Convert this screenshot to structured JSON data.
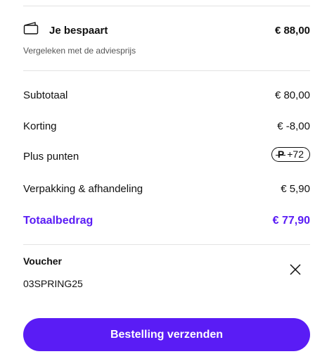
{
  "savings": {
    "title": "Je bespaart",
    "amount": "€ 88,00",
    "subtitle": "Vergeleken met de adviesprijs",
    "icon": "wallet-icon"
  },
  "summary": {
    "subtotal_label": "Subtotaal",
    "subtotal_value": "€ 80,00",
    "discount_label": "Korting",
    "discount_value": "€ -8,00",
    "points_label": "Plus punten",
    "points_value": "+72",
    "points_icon": "plus-points-icon",
    "packaging_label": "Verpakking & afhandeling",
    "packaging_value": "€ 5,90",
    "total_label": "Totaalbedrag",
    "total_value": "€ 77,90"
  },
  "voucher": {
    "title": "Voucher",
    "code": "03SPRING25",
    "remove_icon": "close-icon"
  },
  "actions": {
    "submit_label": "Bestelling verzenden"
  },
  "colors": {
    "accent": "#5a1cf5",
    "text": "#111111",
    "muted": "#555555",
    "divider": "#e3e3e3"
  }
}
